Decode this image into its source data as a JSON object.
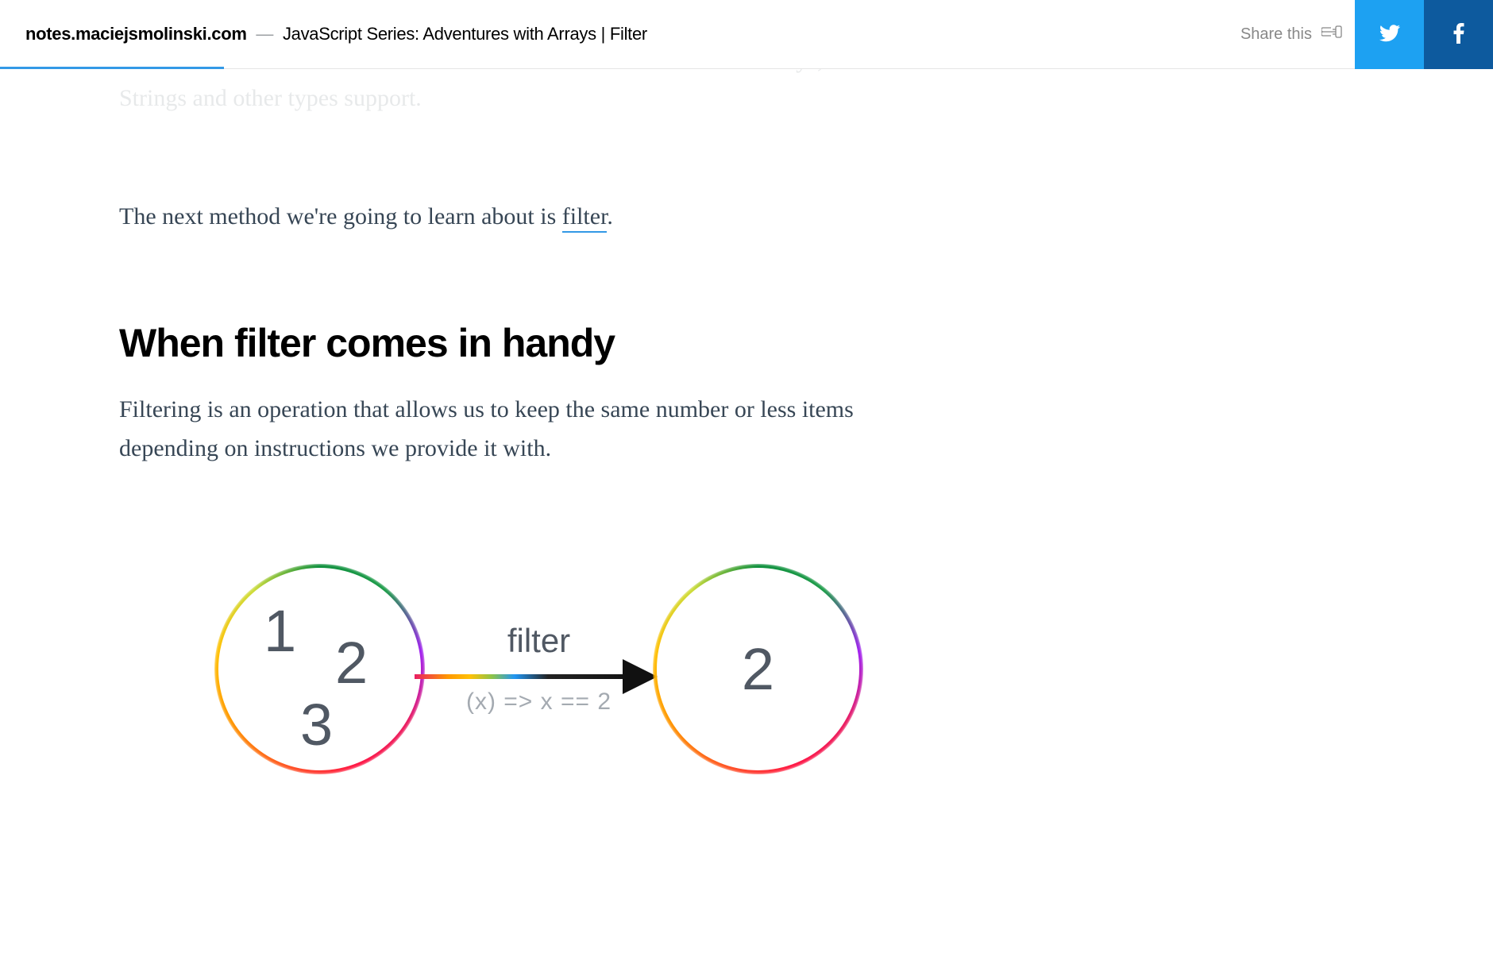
{
  "header": {
    "site": "notes.maciejsmolinski.com",
    "subtitle": "JavaScript Series: Adventures with Arrays | Filter",
    "share_label": "Share this"
  },
  "content": {
    "faded_line_1": "documentation contains a lot of useful information about methods Arrays,",
    "faded_line_2": "Strings and other types support.",
    "intro_text_prefix": "The next method we're going to learn about is ",
    "intro_link": "filter",
    "intro_text_suffix": ".",
    "heading": "When filter comes in handy",
    "section_text": "Filtering is an operation that allows us to keep the same number or less items depending on instructions we provide it with."
  },
  "diagram": {
    "left_values": [
      "1",
      "2",
      "3"
    ],
    "arrow_label": "filter",
    "arrow_sublabel": "(x) => x == 2",
    "right_value": "2"
  }
}
